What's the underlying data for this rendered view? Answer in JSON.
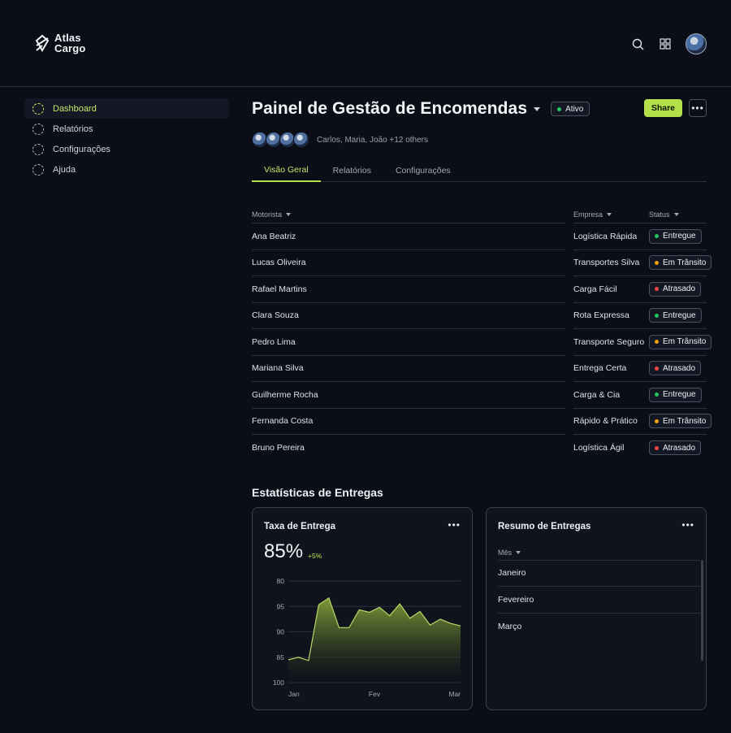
{
  "brand": {
    "line1": "Atlas",
    "line2": "Cargo"
  },
  "colors": {
    "accent": "#b4e14a",
    "green": "#22c55e",
    "orange": "#f59e0b",
    "red": "#ef4444"
  },
  "header": {
    "icons": [
      "search-icon",
      "grid-icon",
      "avatar"
    ]
  },
  "sidebar": {
    "items": [
      {
        "label": "Dashboard"
      },
      {
        "label": "Relatórios"
      },
      {
        "label": "Configurações"
      },
      {
        "label": "Ajuda"
      }
    ]
  },
  "page": {
    "title": "Painel de Gestão de Encomendas",
    "badge": "Ativo",
    "share_label": "Share",
    "collaborators": "Carlos, Maria, João +12 others"
  },
  "tabs": [
    {
      "label": "Visão Geral"
    },
    {
      "label": "Relatórios"
    },
    {
      "label": "Configurações"
    }
  ],
  "table": {
    "headers": {
      "driver": "Motorista",
      "company": "Empresa",
      "status": "Status"
    },
    "rows": [
      {
        "driver": "Ana Beatriz",
        "company": "Logística Rápida",
        "status": "Entregue",
        "tone": "green"
      },
      {
        "driver": "Lucas Oliveira",
        "company": "Transportes Silva",
        "status": "Em Trânsito",
        "tone": "orange"
      },
      {
        "driver": "Rafael Martins",
        "company": "Carga Fácil",
        "status": "Atrasado",
        "tone": "red"
      },
      {
        "driver": "Clara Souza",
        "company": "Rota Expressa",
        "status": "Entregue",
        "tone": "green"
      },
      {
        "driver": "Pedro Lima",
        "company": "Transporte Seguro",
        "status": "Em Trânsito",
        "tone": "orange"
      },
      {
        "driver": "Mariana Silva",
        "company": "Entrega Certa",
        "status": "Atrasado",
        "tone": "red"
      },
      {
        "driver": "Guilherme Rocha",
        "company": "Carga & Cia",
        "status": "Entregue",
        "tone": "green"
      },
      {
        "driver": "Fernanda Costa",
        "company": "Rápido & Prático",
        "status": "Em Trânsito",
        "tone": "orange"
      },
      {
        "driver": "Bruno Pereira",
        "company": "Logística Ágil",
        "status": "Atrasado",
        "tone": "red"
      }
    ]
  },
  "stats": {
    "title": "Estatísticas de Entregas",
    "rate_card": {
      "title": "Taxa de Entrega",
      "value": "85%",
      "delta": "+5%"
    },
    "summary_card": {
      "title": "Resumo de Entregas",
      "column": "Mês",
      "months": [
        "Janeiro",
        "Fevereiro",
        "Março"
      ]
    }
  },
  "chart_data": {
    "type": "area",
    "y_ticks": [
      "80",
      "95",
      "90",
      "85",
      "100"
    ],
    "x_ticks": [
      "Jan",
      "Fev",
      "Mar"
    ],
    "ylim": [
      84,
      96
    ],
    "values": [
      86.7,
      87.0,
      86.6,
      93.2,
      94.0,
      90.5,
      90.5,
      92.6,
      92.3,
      92.9,
      91.9,
      93.3,
      91.6,
      92.4,
      90.8,
      91.5,
      91.0,
      90.7
    ],
    "grid": true
  }
}
